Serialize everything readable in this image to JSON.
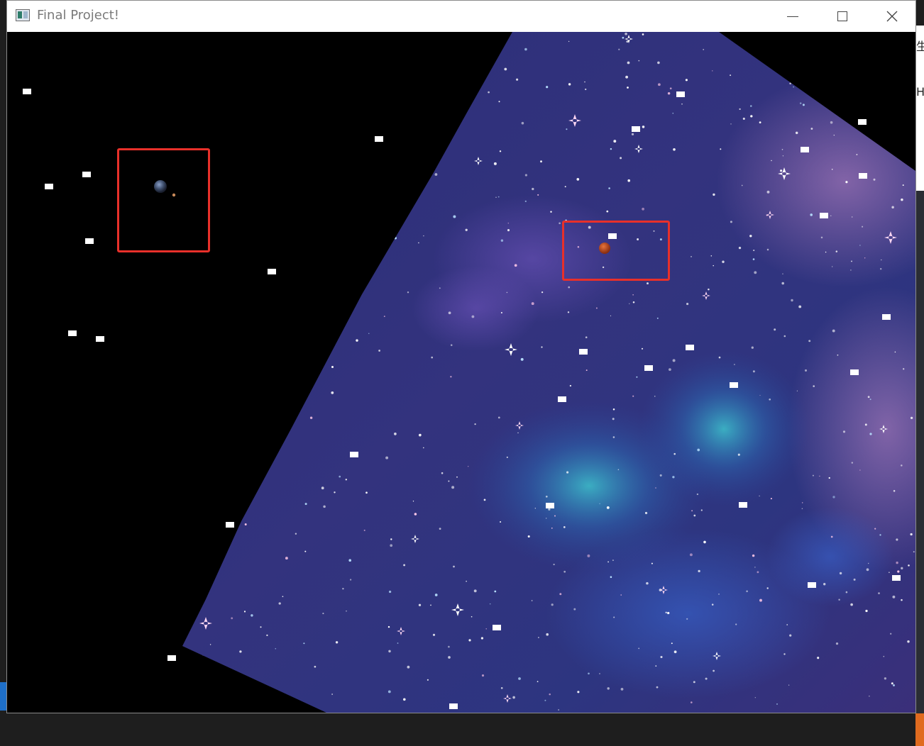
{
  "window": {
    "title": "Final Project!",
    "controls": {
      "minimize": "minimize",
      "maximize": "maximize",
      "close": "close"
    }
  },
  "desktop": {
    "right_text_1": "生",
    "right_text_2": "HY"
  },
  "scene": {
    "background_color": "#000000",
    "skybox_colors": [
      "#2a2a6a",
      "#3b3a8a",
      "#5a3f9a",
      "#9a6ab8"
    ],
    "highlight_color": "#e8302a",
    "objects": [
      {
        "name": "earth-with-moon",
        "description": "small planet with orbiting moon"
      },
      {
        "name": "red-planet",
        "description": "small red/orange planet"
      }
    ]
  },
  "colors": {
    "titlebar": "#ffffff",
    "title_text": "#7a7a7a",
    "star_quads": "#ffffff"
  }
}
